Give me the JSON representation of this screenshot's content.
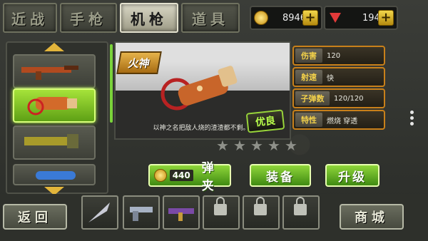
{
  "tabs": [
    {
      "label": "近战",
      "active": false
    },
    {
      "label": "手枪",
      "active": false
    },
    {
      "label": "机枪",
      "active": true
    },
    {
      "label": "道具",
      "active": false
    }
  ],
  "currency": {
    "gold": "8946",
    "gems": "194"
  },
  "weapon": {
    "name": "火神",
    "rarity_badge": "优良",
    "description": "以神之名把敌人烧的渣渣都不剩。",
    "stars_filled": 0,
    "stars_total": 5
  },
  "stats": [
    {
      "label": "伤害",
      "value": "120"
    },
    {
      "label": "射速",
      "value": "快"
    },
    {
      "label": "子弹数",
      "value": "120/120"
    },
    {
      "label": "特性",
      "value": "燃烧 穿透"
    }
  ],
  "ammo_button": {
    "price": "440",
    "label": "弹夹"
  },
  "equip_button": {
    "label": "装备"
  },
  "upgrade_button": {
    "label": "升级"
  },
  "back_button": {
    "label": "返回"
  },
  "shop_button": {
    "label": "商城"
  },
  "colors": {
    "accent_green": "#8fd63a",
    "stat_border": "#c8801a",
    "stat_label": "#f4d24a"
  },
  "bottom_slots": [
    {
      "icon": "blade-icon",
      "locked": false
    },
    {
      "icon": "pistol-icon",
      "locked": false
    },
    {
      "icon": "smg-icon",
      "locked": false
    },
    {
      "icon": "lock-icon",
      "locked": true
    },
    {
      "icon": "lock-icon",
      "locked": true
    },
    {
      "icon": "lock-icon",
      "locked": true
    }
  ]
}
